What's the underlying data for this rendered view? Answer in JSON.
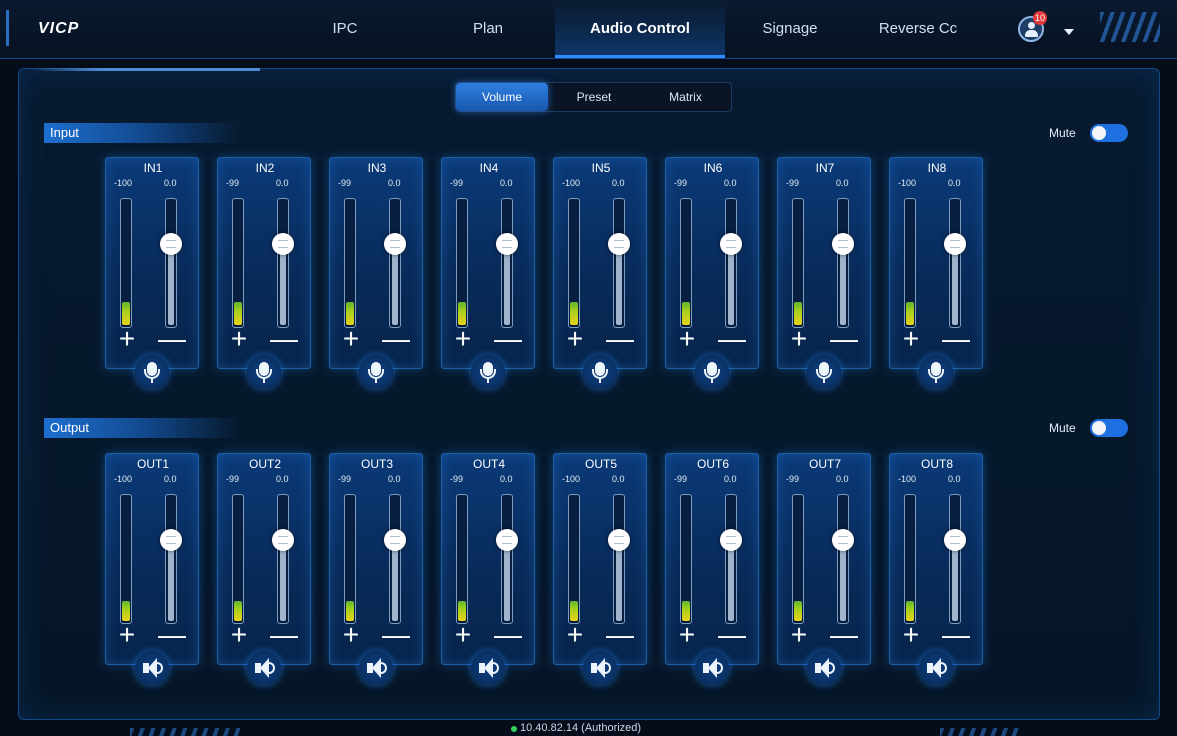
{
  "app": {
    "logo": "VICP"
  },
  "nav": {
    "tabs": [
      {
        "label": "IPC"
      },
      {
        "label": "Plan"
      },
      {
        "label": "Audio Control",
        "active": true
      },
      {
        "label": "Signage"
      },
      {
        "label": "Reverse Cc"
      }
    ],
    "notification_count": "10",
    "user_icon": "user-avatar-icon"
  },
  "segmented": {
    "items": [
      "Volume",
      "Preset",
      "Matrix"
    ],
    "active": "Volume"
  },
  "input": {
    "section_label": "Input",
    "mute_label": "Mute",
    "mute_on": true,
    "channels": [
      {
        "name": "IN1",
        "level": "-100",
        "gain": "0.0",
        "meter": 0.18,
        "fader": 0.65
      },
      {
        "name": "IN2",
        "level": "-99",
        "gain": "0.0",
        "meter": 0.18,
        "fader": 0.65
      },
      {
        "name": "IN3",
        "level": "-99",
        "gain": "0.0",
        "meter": 0.18,
        "fader": 0.65
      },
      {
        "name": "IN4",
        "level": "-99",
        "gain": "0.0",
        "meter": 0.18,
        "fader": 0.65
      },
      {
        "name": "IN5",
        "level": "-100",
        "gain": "0.0",
        "meter": 0.18,
        "fader": 0.65
      },
      {
        "name": "IN6",
        "level": "-99",
        "gain": "0.0",
        "meter": 0.18,
        "fader": 0.65
      },
      {
        "name": "IN7",
        "level": "-99",
        "gain": "0.0",
        "meter": 0.18,
        "fader": 0.65
      },
      {
        "name": "IN8",
        "level": "-100",
        "gain": "0.0",
        "meter": 0.18,
        "fader": 0.65
      }
    ],
    "channel_icon": "microphone-icon"
  },
  "output": {
    "section_label": "Output",
    "mute_label": "Mute",
    "mute_on": true,
    "channels": [
      {
        "name": "OUT1",
        "level": "-100",
        "gain": "0.0",
        "meter": 0.16,
        "fader": 0.65
      },
      {
        "name": "OUT2",
        "level": "-99",
        "gain": "0.0",
        "meter": 0.16,
        "fader": 0.65
      },
      {
        "name": "OUT3",
        "level": "-99",
        "gain": "0.0",
        "meter": 0.16,
        "fader": 0.65
      },
      {
        "name": "OUT4",
        "level": "-99",
        "gain": "0.0",
        "meter": 0.16,
        "fader": 0.65
      },
      {
        "name": "OUT5",
        "level": "-100",
        "gain": "0.0",
        "meter": 0.16,
        "fader": 0.65
      },
      {
        "name": "OUT6",
        "level": "-99",
        "gain": "0.0",
        "meter": 0.16,
        "fader": 0.65
      },
      {
        "name": "OUT7",
        "level": "-99",
        "gain": "0.0",
        "meter": 0.16,
        "fader": 0.65
      },
      {
        "name": "OUT8",
        "level": "-100",
        "gain": "0.0",
        "meter": 0.16,
        "fader": 0.65
      }
    ],
    "channel_icon": "speaker-icon"
  },
  "controls": {
    "plus": "+",
    "minus": "—"
  },
  "status": {
    "text": "10.40.82.14 (Authorized)"
  },
  "colors": {
    "accent": "#1e6fe0",
    "status_ok": "#30d05a",
    "meter": "#e9d21a"
  }
}
